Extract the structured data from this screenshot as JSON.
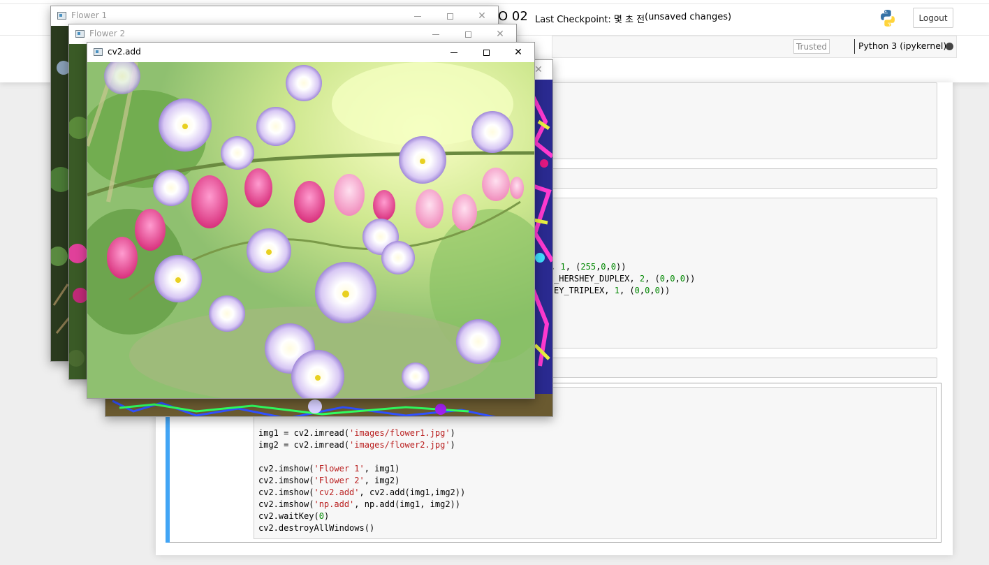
{
  "header": {
    "notebook_name_tail": "O  02",
    "checkpoint_label": "Last Checkpoint:",
    "checkpoint_value": "몇 초 전",
    "autosave": "(unsaved changes)",
    "logout_label": "Logout",
    "trusted_label": "Trusted",
    "kernel_name": "Python 3 (ipykernel)"
  },
  "cell_fragments": {
    "line1_tail": ", 1, (255,0,0))",
    "line2_tail": "_HERSHEY_DUPLEX, 2, (0,0,0))",
    "line3_tail": "EY_TRIPLEX, 1, (0,0,0))"
  },
  "active_cell": {
    "code": [
      "img1 = cv2.imread('images/flower1.jpg')",
      "img2 = cv2.imread('images/flower2.jpg')",
      "",
      "cv2.imshow('Flower 1', img1)",
      "cv2.imshow('Flower 2', img2)",
      "cv2.imshow('cv2.add', cv2.add(img1,img2))",
      "cv2.imshow('np.add', np.add(img1, img2))",
      "cv2.waitKey(0)",
      "cv2.destroyAllWindows()"
    ]
  },
  "windows": {
    "flower1": {
      "title": "Flower 1"
    },
    "flower2": {
      "title": "Flower 2"
    },
    "cv2add": {
      "title": "cv2.add"
    }
  },
  "colors": {
    "selected_cell_bar": "#42a5f5",
    "python_blue": "#3572a5",
    "python_yellow": "#ffd43b"
  }
}
